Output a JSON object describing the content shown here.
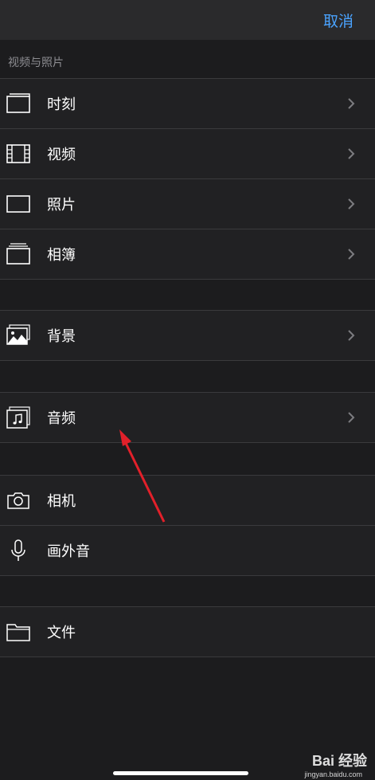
{
  "header": {
    "cancel_label": "取消"
  },
  "section": {
    "title": "视频与照片"
  },
  "items": [
    {
      "label": "时刻"
    },
    {
      "label": "视频"
    },
    {
      "label": "照片"
    },
    {
      "label": "相簿"
    },
    {
      "label": "背景"
    },
    {
      "label": "音频"
    },
    {
      "label": "相机"
    },
    {
      "label": "画外音"
    },
    {
      "label": "文件"
    }
  ],
  "watermark": {
    "brand": "Bai 经验",
    "site": "jingyan.baidu.com"
  },
  "colors": {
    "accent": "#4aa3ff",
    "arrow": "#e2202a"
  }
}
